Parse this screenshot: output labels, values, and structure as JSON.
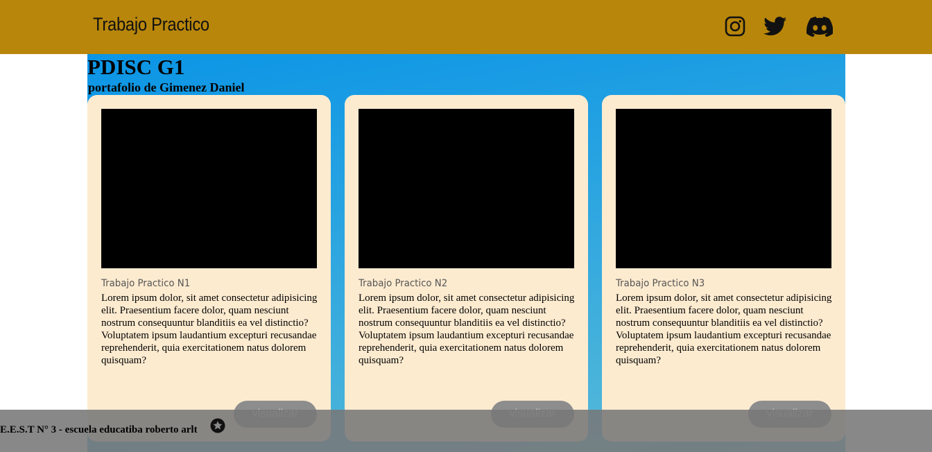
{
  "header": {
    "brand": "Trabajo Practico",
    "social_icons": [
      "instagram-icon",
      "twitter-icon",
      "discord-icon"
    ],
    "background_color": "#b8860b"
  },
  "main": {
    "title": "PDISC G1",
    "subtitle": "portafolio de Gimenez Daniel",
    "cards": [
      {
        "title": "Trabajo Practico N1",
        "text": "Lorem ipsum dolor, sit amet consectetur adipisicing elit. Praesentium facere dolor, quam nesciunt nostrum consequuntur blanditiis ea vel distinctio? Voluptatem ipsum laudantium excepturi recusandae reprehenderit, quia exercitationem natus dolorem quisquam?",
        "button": "visualizar"
      },
      {
        "title": "Trabajo Practico N2",
        "text": "Lorem ipsum dolor, sit amet consectetur adipisicing elit. Praesentium facere dolor, quam nesciunt nostrum consequuntur blanditiis ea vel distinctio? Voluptatem ipsum laudantium excepturi recusandae reprehenderit, quia exercitationem natus dolorem quisquam?",
        "button": "visualizar"
      },
      {
        "title": "Trabajo Practico N3",
        "text": "Lorem ipsum dolor, sit amet consectetur adipisicing elit. Praesentium facere dolor, quam nesciunt nostrum consequuntur blanditiis ea vel distinctio? Voluptatem ipsum laudantium excepturi recusandae reprehenderit, quia exercitationem natus dolorem quisquam?",
        "button": "visualizar"
      }
    ]
  },
  "footer": {
    "text": "E.E.S.T N° 3 - escuela educatiba roberto arlt",
    "icon": "star-icon"
  }
}
